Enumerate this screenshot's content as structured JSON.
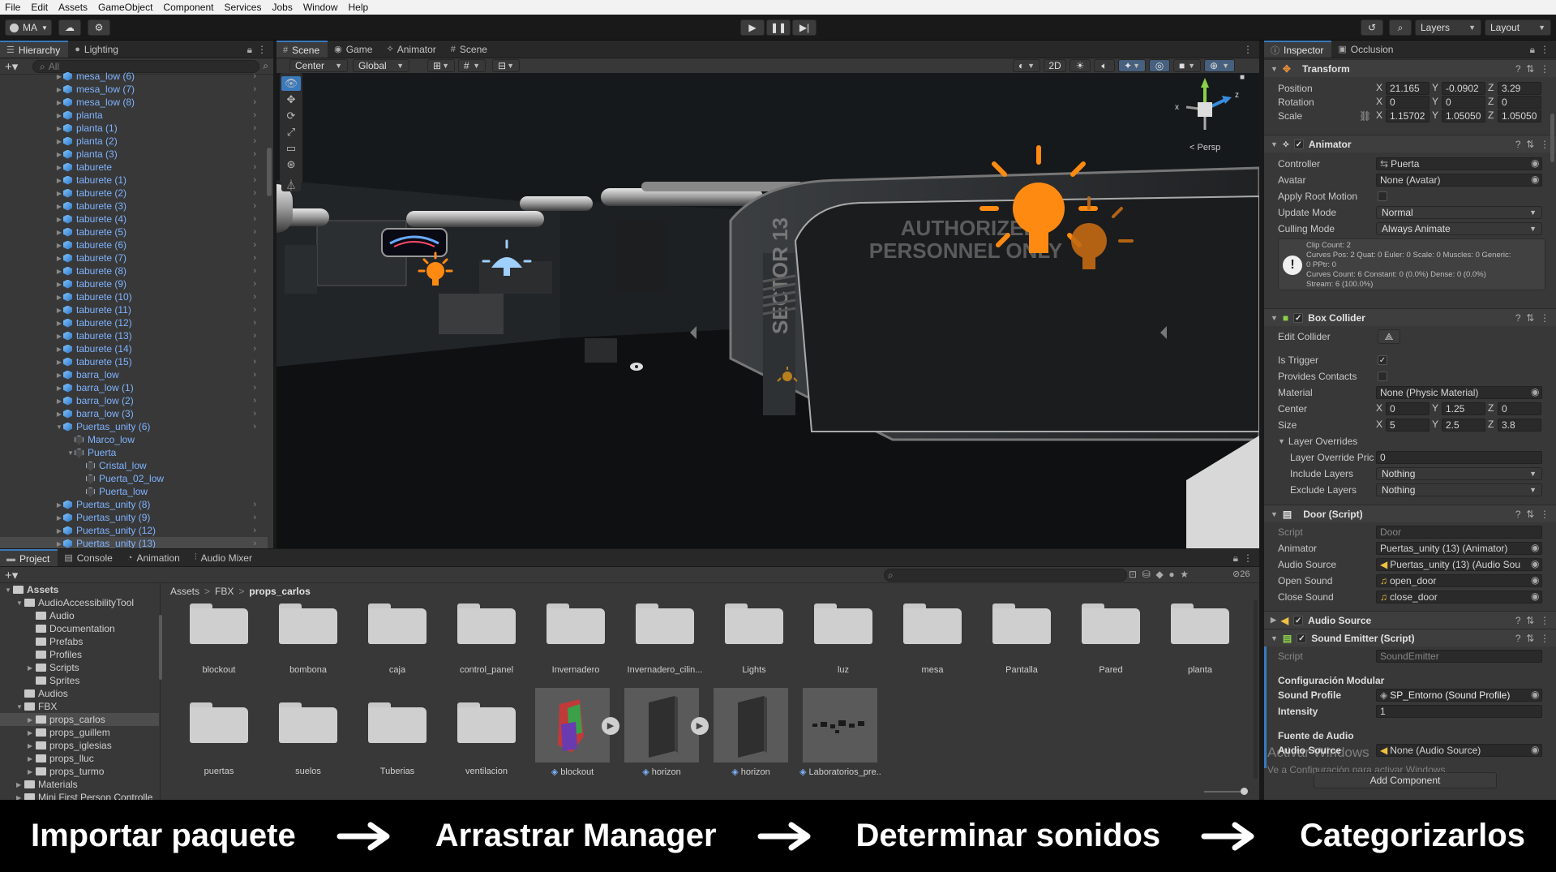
{
  "menu": [
    "File",
    "Edit",
    "Assets",
    "GameObject",
    "Component",
    "Services",
    "Jobs",
    "Window",
    "Help"
  ],
  "toolbar": {
    "account": "MA",
    "layers": "Layers",
    "layout": "Layout"
  },
  "hierarchy": {
    "tabs": [
      "Hierarchy",
      "Lighting"
    ],
    "search_placeholder": "All",
    "items": [
      {
        "label": "mesa_low (6)",
        "depth": 0,
        "type": "prefab",
        "arrow": "right"
      },
      {
        "label": "mesa_low (7)",
        "depth": 0,
        "type": "prefab",
        "arrow": "right"
      },
      {
        "label": "mesa_low (8)",
        "depth": 0,
        "type": "prefab",
        "arrow": "right"
      },
      {
        "label": "planta",
        "depth": 0,
        "type": "prefab",
        "arrow": "right"
      },
      {
        "label": "planta (1)",
        "depth": 0,
        "type": "prefab",
        "arrow": "right"
      },
      {
        "label": "planta (2)",
        "depth": 0,
        "type": "prefab",
        "arrow": "right"
      },
      {
        "label": "planta (3)",
        "depth": 0,
        "type": "prefab",
        "arrow": "right"
      },
      {
        "label": "taburete",
        "depth": 0,
        "type": "prefab",
        "arrow": "right"
      },
      {
        "label": "taburete (1)",
        "depth": 0,
        "type": "prefab",
        "arrow": "right"
      },
      {
        "label": "taburete (2)",
        "depth": 0,
        "type": "prefab",
        "arrow": "right"
      },
      {
        "label": "taburete (3)",
        "depth": 0,
        "type": "prefab",
        "arrow": "right"
      },
      {
        "label": "taburete (4)",
        "depth": 0,
        "type": "prefab",
        "arrow": "right"
      },
      {
        "label": "taburete (5)",
        "depth": 0,
        "type": "prefab",
        "arrow": "right"
      },
      {
        "label": "taburete (6)",
        "depth": 0,
        "type": "prefab",
        "arrow": "right"
      },
      {
        "label": "taburete (7)",
        "depth": 0,
        "type": "prefab",
        "arrow": "right"
      },
      {
        "label": "taburete (8)",
        "depth": 0,
        "type": "prefab",
        "arrow": "right"
      },
      {
        "label": "taburete (9)",
        "depth": 0,
        "type": "prefab",
        "arrow": "right"
      },
      {
        "label": "taburete (10)",
        "depth": 0,
        "type": "prefab",
        "arrow": "right"
      },
      {
        "label": "taburete (11)",
        "depth": 0,
        "type": "prefab",
        "arrow": "right"
      },
      {
        "label": "taburete (12)",
        "depth": 0,
        "type": "prefab",
        "arrow": "right"
      },
      {
        "label": "taburete (13)",
        "depth": 0,
        "type": "prefab",
        "arrow": "right"
      },
      {
        "label": "taburete (14)",
        "depth": 0,
        "type": "prefab",
        "arrow": "right"
      },
      {
        "label": "taburete (15)",
        "depth": 0,
        "type": "prefab",
        "arrow": "right"
      },
      {
        "label": "barra_low",
        "depth": 0,
        "type": "prefab",
        "arrow": "right"
      },
      {
        "label": "barra_low (1)",
        "depth": 0,
        "type": "prefab",
        "arrow": "right"
      },
      {
        "label": "barra_low (2)",
        "depth": 0,
        "type": "prefab",
        "arrow": "right"
      },
      {
        "label": "barra_low (3)",
        "depth": 0,
        "type": "prefab",
        "arrow": "right"
      },
      {
        "label": "Puertas_unity (6)",
        "depth": 0,
        "type": "prefab",
        "arrow": "down"
      },
      {
        "label": "Marco_low",
        "depth": 1,
        "type": "object",
        "arrow": ""
      },
      {
        "label": "Puerta",
        "depth": 1,
        "type": "object",
        "arrow": "down"
      },
      {
        "label": "Cristal_low",
        "depth": 2,
        "type": "object",
        "arrow": ""
      },
      {
        "label": "Puerta_02_low",
        "depth": 2,
        "type": "object",
        "arrow": ""
      },
      {
        "label": "Puerta_low",
        "depth": 2,
        "type": "object",
        "arrow": ""
      },
      {
        "label": "Puertas_unity (8)",
        "depth": 0,
        "type": "prefab",
        "arrow": "right"
      },
      {
        "label": "Puertas_unity (9)",
        "depth": 0,
        "type": "prefab",
        "arrow": "right"
      },
      {
        "label": "Puertas_unity (12)",
        "depth": 0,
        "type": "prefab",
        "arrow": "right"
      },
      {
        "label": "Puertas_unity (13)",
        "depth": 0,
        "type": "prefab",
        "arrow": "right",
        "selected": true
      }
    ]
  },
  "scene_view": {
    "tabs": [
      "Scene",
      "Game",
      "Animator",
      "Scene"
    ],
    "pivot": "Center",
    "space": "Global",
    "mode_2d": "2D",
    "persp_label": "Persp",
    "gizmo_axes": [
      "x",
      "y",
      "z"
    ],
    "sign_text_line1": "AUTHORIZED",
    "sign_text_line2": "PERSONNEL ONLY",
    "wall_text": "SECTOR 13"
  },
  "inspector": {
    "tabs": [
      "Inspector",
      "Occlusion"
    ],
    "transform": {
      "title": "Transform",
      "position": {
        "label": "Position",
        "x": "21.165",
        "y": "-0.0902",
        "z": "3.29"
      },
      "rotation": {
        "label": "Rotation",
        "x": "0",
        "y": "0",
        "z": "0"
      },
      "scale": {
        "label": "Scale",
        "x": "1.15702",
        "y": "1.05050",
        "z": "1.05050"
      }
    },
    "animator": {
      "title": "Animator",
      "controller_label": "Controller",
      "controller": "Puerta",
      "avatar_label": "Avatar",
      "avatar": "None (Avatar)",
      "root_motion_label": "Apply Root Motion",
      "update_mode_label": "Update Mode",
      "update_mode": "Normal",
      "culling_label": "Culling Mode",
      "culling": "Always Animate",
      "info_lines": [
        "Clip Count: 2",
        "Curves Pos: 2 Quat: 0 Euler: 0 Scale: 0 Muscles: 0 Generic:",
        "0 PPtr: 0",
        "Curves Count: 6 Constant: 0 (0.0%) Dense: 0 (0.0%)",
        "Stream: 6 (100.0%)"
      ]
    },
    "box_collider": {
      "title": "Box Collider",
      "edit_label": "Edit Collider",
      "trigger_label": "Is Trigger",
      "contacts_label": "Provides Contacts",
      "material_label": "Material",
      "material": "None (Physic Material)",
      "center": {
        "label": "Center",
        "x": "0",
        "y": "1.25",
        "z": "0"
      },
      "size": {
        "label": "Size",
        "x": "5",
        "y": "2.5",
        "z": "3.8"
      },
      "overrides_label": "Layer Overrides",
      "priority_label": "Layer Override Pric",
      "priority": "0",
      "include_label": "Include Layers",
      "include": "Nothing",
      "exclude_label": "Exclude Layers",
      "exclude": "Nothing"
    },
    "door_script": {
      "title": "Door (Script)",
      "script_label": "Script",
      "script": "Door",
      "animator_label": "Animator",
      "animator": "Puertas_unity (13) (Animator)",
      "audio_label": "Audio Source",
      "audio": "Puertas_unity (13) (Audio Sou",
      "open_label": "Open Sound",
      "open": "open_door",
      "close_label": "Close Sound",
      "close": "close_door"
    },
    "audio_source": {
      "title": "Audio Source"
    },
    "sound_emitter": {
      "title": "Sound Emitter (Script)",
      "script_label": "Script",
      "script": "SoundEmitter",
      "section1": "Configuración Modular",
      "profile_label": "Sound Profile",
      "profile": "SP_Entorno (Sound Profile)",
      "intensity_label": "Intensity",
      "intensity": "1",
      "section2": "Fuente de Audio",
      "source_label": "Audio Source",
      "source": "None (Audio Source)"
    },
    "add_component": "Add Component",
    "watermark1": "Activar Windows",
    "watermark2": "Ve a Configuración para activar Windows."
  },
  "project": {
    "tabs": [
      "Project",
      "Console",
      "Animation",
      "Audio Mixer"
    ],
    "hidden_count": "26",
    "breadcrumb": [
      "Assets",
      "FBX",
      "props_carlos"
    ],
    "tree": [
      {
        "label": "Assets",
        "depth": 0,
        "arrow": "down",
        "bold": true
      },
      {
        "label": "AudioAccessibilityTool",
        "depth": 1,
        "arrow": "down"
      },
      {
        "label": "Audio",
        "depth": 2,
        "arrow": ""
      },
      {
        "label": "Documentation",
        "depth": 2,
        "arrow": ""
      },
      {
        "label": "Prefabs",
        "depth": 2,
        "arrow": ""
      },
      {
        "label": "Profiles",
        "depth": 2,
        "arrow": ""
      },
      {
        "label": "Scripts",
        "depth": 2,
        "arrow": "right"
      },
      {
        "label": "Sprites",
        "depth": 2,
        "arrow": ""
      },
      {
        "label": "Audios",
        "depth": 1,
        "arrow": ""
      },
      {
        "label": "FBX",
        "depth": 1,
        "arrow": "down"
      },
      {
        "label": "props_carlos",
        "depth": 2,
        "arrow": "right",
        "selected": true
      },
      {
        "label": "props_guillem",
        "depth": 2,
        "arrow": "right"
      },
      {
        "label": "props_iglesias",
        "depth": 2,
        "arrow": "right"
      },
      {
        "label": "props_lluc",
        "depth": 2,
        "arrow": "right"
      },
      {
        "label": "props_turmo",
        "depth": 2,
        "arrow": "right"
      },
      {
        "label": "Materials",
        "depth": 1,
        "arrow": "right"
      },
      {
        "label": "Mini First Person Controlle",
        "depth": 1,
        "arrow": "right"
      }
    ],
    "folders_row1": [
      "blockout",
      "bombona",
      "caja",
      "control_panel",
      "Invernadero",
      "Invernadero_cilin...",
      "Lights",
      "luz",
      "mesa",
      "Pantalla",
      "Pared",
      "planta"
    ],
    "folders_row2": [
      "puertas",
      "suelos",
      "Tuberias",
      "ventilacion"
    ],
    "assets_row2": [
      "blockout",
      "horizon",
      "horizon",
      "Laboratorios_pre..."
    ]
  },
  "banner": {
    "steps": [
      "Importar paquete",
      "Arrastrar Manager",
      "Determinar sonidos",
      "Categorizarlos"
    ]
  },
  "colors": {
    "accent": "#3a79bb",
    "light_orange": "#ff8a12",
    "prefab_blue": "#7fb3ff"
  }
}
